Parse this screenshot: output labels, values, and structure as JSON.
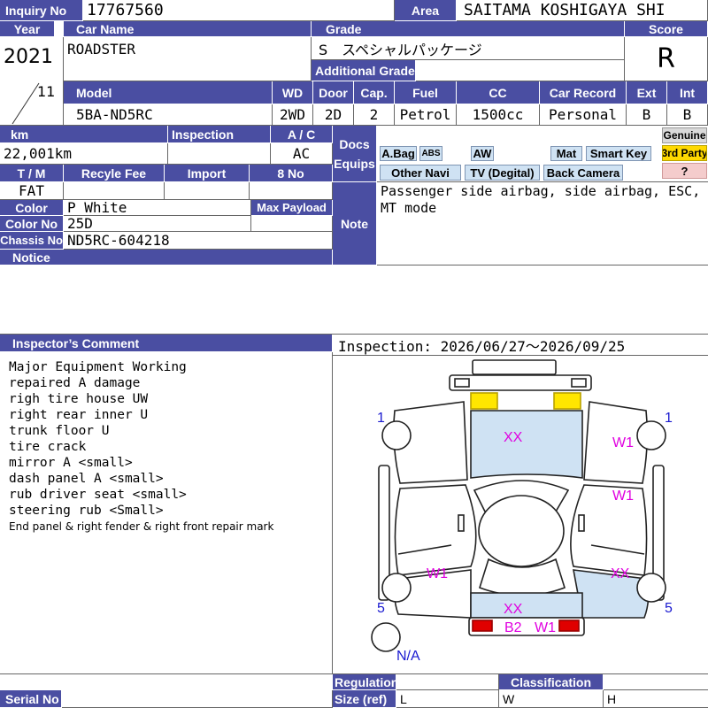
{
  "labels": {
    "inquiry_no": "Inquiry No",
    "area": "Area",
    "year": "Year",
    "car_name": "Car Name",
    "grade": "Grade",
    "score": "Score",
    "additional_grade": "Additional Grade",
    "model": "Model",
    "wd": "WD",
    "door": "Door",
    "cap": "Cap.",
    "fuel": "Fuel",
    "cc": "CC",
    "car_record": "Car Record",
    "ext": "Ext",
    "int": "Int",
    "km": "km",
    "inspection": "Inspection",
    "ac": "A / C",
    "docs": "Docs",
    "equips": "Equips",
    "tm": "T / M",
    "recycle_fee": "Recyle Fee",
    "import": "Import",
    "eight_no": "8 No",
    "color": "Color",
    "max_payload": "Max Payload",
    "color_no": "Color No",
    "chassis_no": "Chassis No",
    "notice": "Notice",
    "note": "Note",
    "inspectors_comment": "Inspector’s Comment",
    "regulation": "Regulation",
    "classification": "Classification",
    "serial_no": "Serial No",
    "size_ref": "Size (ref)",
    "size_l": "L",
    "size_w": "W",
    "size_h": "H"
  },
  "vehicle": {
    "inquiry_no": "17767560",
    "area": "SAITAMA KOSHIGAYA SHI",
    "year": "2021",
    "month": "11",
    "car_name": "ROADSTER",
    "grade": "S　スペシャルパッケージ",
    "score": "R",
    "model": "5BA-ND5RC",
    "wd": "2WD",
    "door": "2D",
    "cap": "2",
    "fuel": "Petrol",
    "cc": "1500cc",
    "car_record": "Personal",
    "ext": "B",
    "int": "B",
    "km": "22,001km",
    "ac": "AC",
    "tm": "FAT",
    "color": "P White",
    "color_no": "25D",
    "chassis_no": "ND5RC-604218"
  },
  "equips": {
    "abag": "A.Bag",
    "abs": "ABS",
    "aw": "AW",
    "mat": "Mat",
    "smart_key": "Smart Key",
    "genuine": "Genuine",
    "other_navi": "Other Navi",
    "tv": "TV (Degital)",
    "back_camera": "Back Camera",
    "third_party": "3rd Party",
    "unknown": "?"
  },
  "note": "Passenger side airbag, side airbag, ESC, MT mode",
  "inspection_period": "Inspection: 2026/06/27～2026/09/25",
  "comments": [
    "Major Equipment Working",
    "repaired A damage",
    "righ tire house UW",
    "right rear inner U",
    "trunk floor U",
    "tire crack",
    "mirror A <small>",
    "dash panel A <small>",
    "rub driver seat <small>",
    "steering rub <Small>"
  ],
  "comment_last": "End panel & right fender & right front repair mark",
  "diagram": {
    "tire_fl": "1",
    "tire_fr": "1",
    "tire_rl": "5",
    "tire_rr": "5",
    "spare": "N/A",
    "hood": "XX",
    "right_front_fender": "W1",
    "right_door": "W1",
    "left_rear": "W1",
    "right_rear_fender": "XX",
    "trunk": "XX",
    "rear_bumper_left": "B2",
    "rear_bumper_right": "W1",
    "colors": {
      "damage_text": "#e000e0",
      "tire_text": "#1a1ad0",
      "panel_fill": "#cfe2f3",
      "highlight_yellow": "#ffe600",
      "tail_red": "#e00000"
    }
  },
  "colors": {
    "header": "#4a4ea2"
  }
}
